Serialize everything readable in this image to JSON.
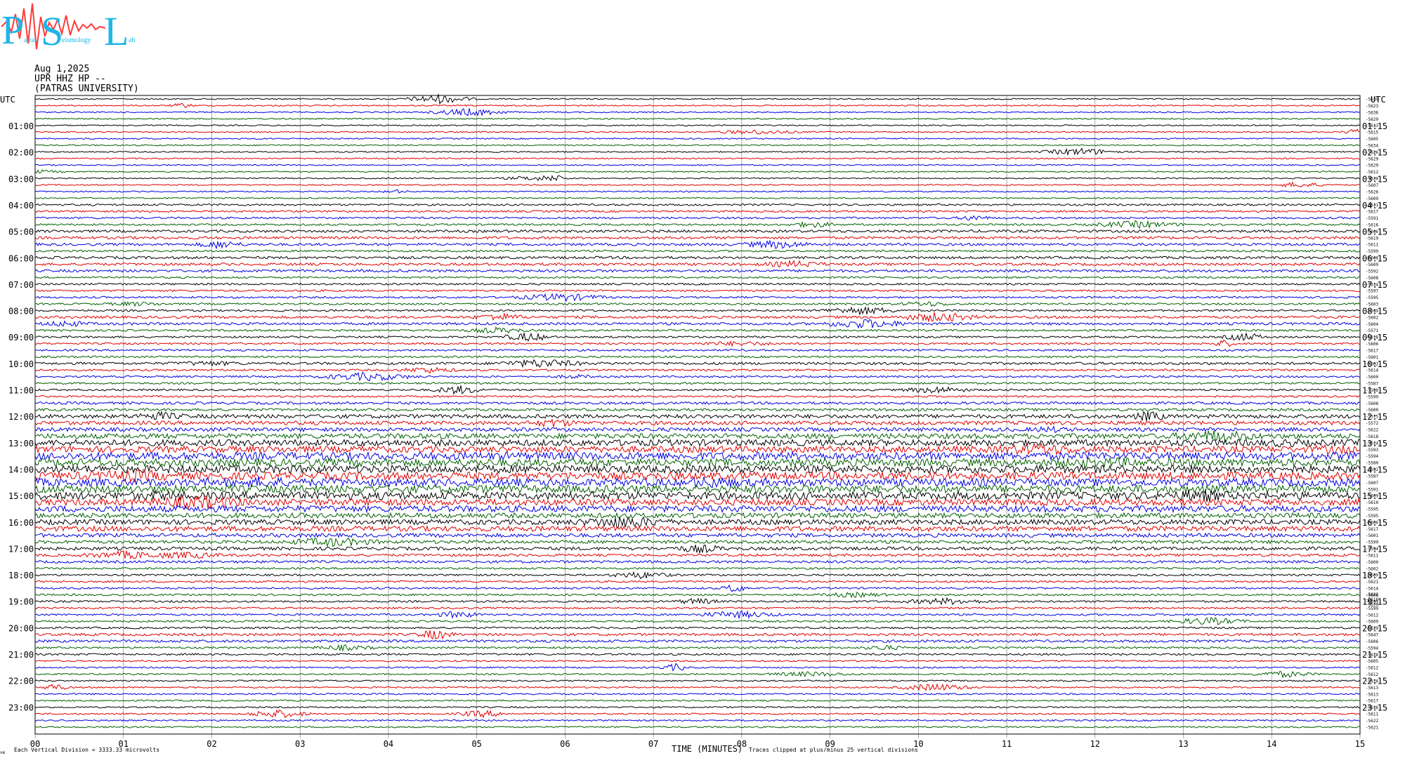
{
  "logo": {
    "letters": [
      "P",
      "S",
      "L"
    ],
    "small_text": [
      "atras",
      "eismology",
      "ab"
    ],
    "colors": {
      "letters": "#1fb6e8",
      "wave": "#ff3b3b"
    }
  },
  "header": {
    "date": "Aug 1,2025",
    "station": "UPR HHZ HP --",
    "institution": "(PATRAS UNIVERSITY)"
  },
  "labels": {
    "utc_left": "UTC",
    "utc_right": "UTC",
    "x_axis_title": "TIME (MINUTES)",
    "vertical_division": "Each Vertical Division = 3333.33 microvolts",
    "clipping_note": "Traces clipped at plus/minus 25 vertical divisions",
    "corner_mark": "ʌɐ"
  },
  "chart_data": {
    "type": "line",
    "xlabel": "TIME (MINUTES)",
    "xlim": [
      0,
      15
    ],
    "x_ticks": [
      "00",
      "01",
      "02",
      "03",
      "04",
      "05",
      "06",
      "07",
      "08",
      "09",
      "10",
      "11",
      "12",
      "13",
      "14",
      "15"
    ],
    "left_hour_labels": [
      "01:00",
      "02:00",
      "03:00",
      "04:00",
      "05:00",
      "06:00",
      "07:00",
      "08:00",
      "09:00",
      "10:00",
      "11:00",
      "12:00",
      "13:00",
      "14:00",
      "15:00",
      "16:00",
      "17:00",
      "18:00",
      "19:00",
      "20:00",
      "21:00",
      "22:00",
      "23:00"
    ],
    "right_hour_labels": [
      "01:15",
      "02:15",
      "03:15",
      "04:15",
      "05:15",
      "06:15",
      "07:15",
      "08:15",
      "09:15",
      "10:15",
      "11:15",
      "12:15",
      "13:15",
      "14:15",
      "15:15",
      "16:15",
      "17:15",
      "18:15",
      "19:15",
      "20:15",
      "21:15",
      "22:15",
      "23:15"
    ],
    "trace_colors": [
      "#000000",
      "#e00000",
      "#0000e0",
      "#006000"
    ],
    "trace_count": 96,
    "trace_offsets": [
      "-5639",
      "-5623",
      "-5636",
      "-5629",
      "-5613",
      "-5615",
      "-5605",
      "-5634",
      "-5626",
      "-5629",
      "-5629",
      "-5612",
      "-5620",
      "-5607",
      "-5626",
      "-5609",
      "-5611",
      "-5617",
      "-5591",
      "-5616",
      "-5606",
      "-5619",
      "-5611",
      "-5599",
      "-5608",
      "-5609",
      "-5592",
      "-5608",
      "-5614",
      "-5597",
      "-5595",
      "-5603",
      "-5599",
      "-5602",
      "-5604",
      "-5571",
      "-5618",
      "-5606",
      "-5617",
      "-5601",
      "-5602",
      "-5614",
      "-5600",
      "-5587",
      "-5588",
      "-5599",
      "-5608",
      "-5600",
      "-5575",
      "-5572",
      "-5622",
      "-5618",
      "-5614",
      "-5593",
      "-5594",
      "-5580",
      "-5592",
      "-5587",
      "-5607",
      "-5591",
      "-5609",
      "-5610",
      "-5595",
      "-5595",
      "-5606",
      "-5617",
      "-5601",
      "-5599",
      "-5594",
      "-5611",
      "-5600",
      "-5602",
      "-5609",
      "-5621",
      "-5614",
      "-5606",
      "-5599",
      "-5599",
      "-5612",
      "-5609",
      "-5629",
      "-5647",
      "-5606",
      "-5594",
      "-5618",
      "-5605",
      "-5612",
      "-5612",
      "-5616",
      "-5613",
      "-5613",
      "-5617",
      "-5616",
      "-5611",
      "-5622",
      "-5621"
    ],
    "trace_offsets_tail": [
      "-5622",
      "-5616",
      "-5620"
    ],
    "activity_level": [
      1,
      1,
      1,
      1,
      1,
      1,
      1,
      1,
      1,
      1,
      1,
      1,
      1,
      1,
      1,
      1,
      1.5,
      1.5,
      1.5,
      1.5,
      2,
      2,
      2,
      1.5,
      2,
      2,
      2,
      1.5,
      1.5,
      1.5,
      1.5,
      1.5,
      1.5,
      2,
      2,
      1.5,
      1.5,
      1.5,
      1.5,
      1.5,
      2,
      1.5,
      1.5,
      1.5,
      1.5,
      1.5,
      2,
      2,
      3,
      3,
      3,
      4,
      5,
      5,
      6,
      6,
      6,
      6,
      6,
      6,
      6,
      5,
      5,
      4,
      4,
      4,
      3,
      2.5,
      2.5,
      2,
      2,
      1.5,
      1.5,
      1.5,
      1.5,
      1.5,
      1.5,
      1.5,
      1.5,
      1.5,
      1.5,
      2,
      2,
      1.5,
      1.5,
      1.2,
      1.2,
      1.2,
      1.2,
      1.2,
      1.2,
      1.2,
      1.2,
      1.2,
      1.2,
      1.2,
      1.2,
      1.2,
      1.2
    ]
  }
}
